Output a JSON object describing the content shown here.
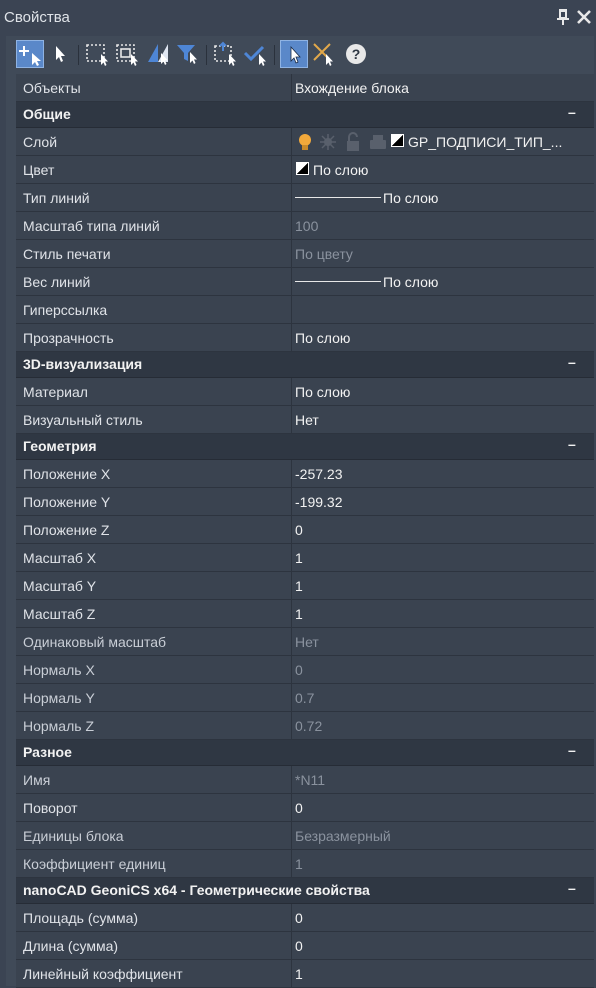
{
  "window": {
    "title": "Свойства"
  },
  "toolbar": {
    "icons": [
      "add-select-icon",
      "select-object-icon",
      "select-window-icon",
      "select-crossing-icon",
      "quick-select-icon",
      "filter-icon",
      "select-similar-icon",
      "select-checked-icon",
      "pick-mode-icon",
      "deselect-icon",
      "help-icon"
    ],
    "help_glyph": "?"
  },
  "header": {
    "label": "Объекты",
    "value": "Вхождение блока"
  },
  "sections": {
    "general": {
      "title": "Общие",
      "layer": {
        "label": "Слой",
        "value": "GP_ПОДПИСИ_ТИП_..."
      },
      "color": {
        "label": "Цвет",
        "value": "По слою"
      },
      "linetype": {
        "label": "Тип линий",
        "value": "По слою"
      },
      "ltscale": {
        "label": "Масштаб типа линий",
        "value": "100"
      },
      "plotstyle": {
        "label": "Стиль печати",
        "value": "По цвету"
      },
      "lineweight": {
        "label": "Вес линий",
        "value": "По слою"
      },
      "hyperlink": {
        "label": "Гиперссылка",
        "value": ""
      },
      "transparency": {
        "label": "Прозрачность",
        "value": "По слою"
      }
    },
    "viz3d": {
      "title": "3D-визуализация",
      "material": {
        "label": "Материал",
        "value": "По слою"
      },
      "visualstyle": {
        "label": "Визуальный стиль",
        "value": "Нет"
      }
    },
    "geometry": {
      "title": "Геометрия",
      "posx": {
        "label": "Положение X",
        "value": "-257.23"
      },
      "posy": {
        "label": "Положение Y",
        "value": "-199.32"
      },
      "posz": {
        "label": "Положение Z",
        "value": "0"
      },
      "scalex": {
        "label": "Масштаб X",
        "value": "1"
      },
      "scaley": {
        "label": "Масштаб Y",
        "value": "1"
      },
      "scalez": {
        "label": "Масштаб Z",
        "value": "1"
      },
      "uniform": {
        "label": "Одинаковый масштаб",
        "value": "Нет"
      },
      "normx": {
        "label": "Нормаль X",
        "value": "0"
      },
      "normy": {
        "label": "Нормаль Y",
        "value": "0.7"
      },
      "normz": {
        "label": "Нормаль Z",
        "value": "0.72"
      }
    },
    "misc": {
      "title": "Разное",
      "name": {
        "label": "Имя",
        "value": "*N11"
      },
      "rotation": {
        "label": "Поворот",
        "value": "0"
      },
      "units": {
        "label": "Единицы блока",
        "value": "Безразмерный"
      },
      "unitfactor": {
        "label": "Коэффициент единиц",
        "value": "1"
      }
    },
    "geonics": {
      "title": "nanoCAD GeoniCS x64 - Геометрические свойства",
      "area": {
        "label": "Площадь (сумма)",
        "value": "0"
      },
      "length": {
        "label": "Длина (сумма)",
        "value": "0"
      },
      "linfactor": {
        "label": "Линейный коэффициент",
        "value": "1"
      }
    }
  },
  "colors": {
    "background": "#3b4453",
    "row": "#3a4350",
    "category": "#2f3743",
    "accent": "#5a88c9",
    "readonly_text": "#8a929e"
  }
}
